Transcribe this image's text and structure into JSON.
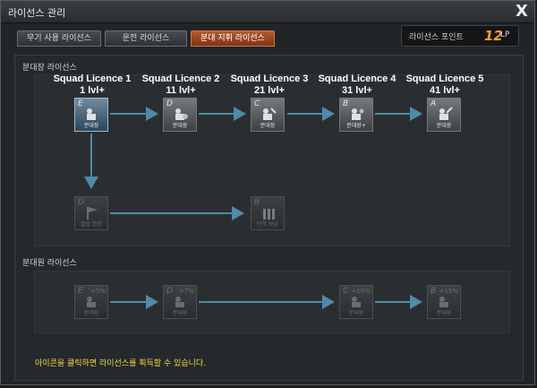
{
  "window": {
    "title": "라이선스 관리",
    "close_label": "X"
  },
  "tabs": [
    {
      "label": "무기 사용 라이선스",
      "active": false
    },
    {
      "label": "운전 라이선스",
      "active": false
    },
    {
      "label": "분대 지휘 라이선스",
      "active": true
    }
  ],
  "license_points": {
    "label": "라이선스 포인트",
    "value": "12",
    "unit": "LP"
  },
  "squad_leader": {
    "title": "분대장 라이선스",
    "levels": [
      {
        "name": "Squad Licence 1",
        "req": "1 lvl+"
      },
      {
        "name": "Squad Licence 2",
        "req": "11 lvl+"
      },
      {
        "name": "Squad Licence 3",
        "req": "21 lvl+"
      },
      {
        "name": "Squad Licence 4",
        "req": "31 lvl+"
      },
      {
        "name": "Squad Licence 5",
        "req": "41 lvl+"
      }
    ],
    "icons": [
      {
        "grade": "E",
        "caption": "분대장"
      },
      {
        "grade": "D",
        "caption": "분대장"
      },
      {
        "grade": "C",
        "caption": "분대장"
      },
      {
        "grade": "B",
        "caption": "분대장+"
      },
      {
        "grade": "A",
        "caption": "분대장"
      }
    ],
    "extra": [
      {
        "grade": "D",
        "caption": "집합 명령"
      },
      {
        "grade": "B",
        "caption": "탄약 보급"
      }
    ]
  },
  "squad_member": {
    "title": "분대원 라이선스",
    "icons": [
      {
        "grade": "E",
        "bonus": "+5%",
        "caption": "분대원"
      },
      {
        "grade": "D",
        "bonus": "+7%",
        "caption": "분대원"
      },
      {
        "grade": "C",
        "bonus": "+10%",
        "caption": "분대원"
      },
      {
        "grade": "B",
        "bonus": "+15%",
        "caption": "분대원"
      }
    ]
  },
  "hint": "아이콘을 클릭하면 라이선스를 획득할 수 있습니다.",
  "colors": {
    "accent": "#ff9c2a",
    "active_tab": "#b65a2e",
    "hint": "#f2dc3c",
    "arrow": "#4f8aa8"
  }
}
